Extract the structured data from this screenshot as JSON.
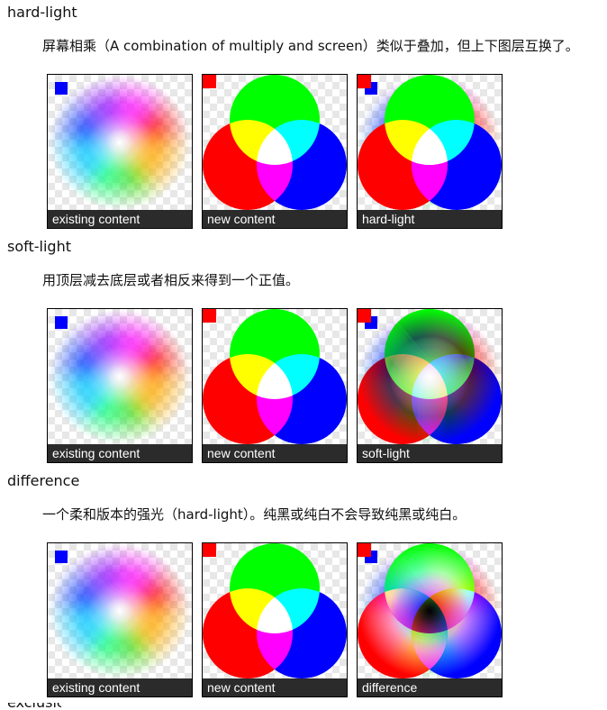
{
  "sections": [
    {
      "title": "hard-light",
      "description": "屏幕相乘（A combination of multiply and screen）类似于叠加，但上下图层互换了。",
      "captions": [
        "existing content",
        "new content",
        "hard-light"
      ]
    },
    {
      "title": "soft-light",
      "description": "用顶层减去底层或者相反来得到一个正值。",
      "captions": [
        "existing content",
        "new content",
        "soft-light"
      ]
    },
    {
      "title": "difference",
      "description": "一个柔和版本的强光（hard-light）。纯黑或纯白不会导致纯黑或纯白。",
      "captions": [
        "existing content",
        "new content",
        "difference"
      ]
    }
  ],
  "next_heading_peek": "exclusion",
  "colors": {
    "caption_bg": "#2b2b2b",
    "square_existing": "#0000ff",
    "square_new": "#ff0000",
    "circle_top": "#00ff00",
    "circle_left": "#ff0000",
    "circle_right": "#0000ff"
  }
}
